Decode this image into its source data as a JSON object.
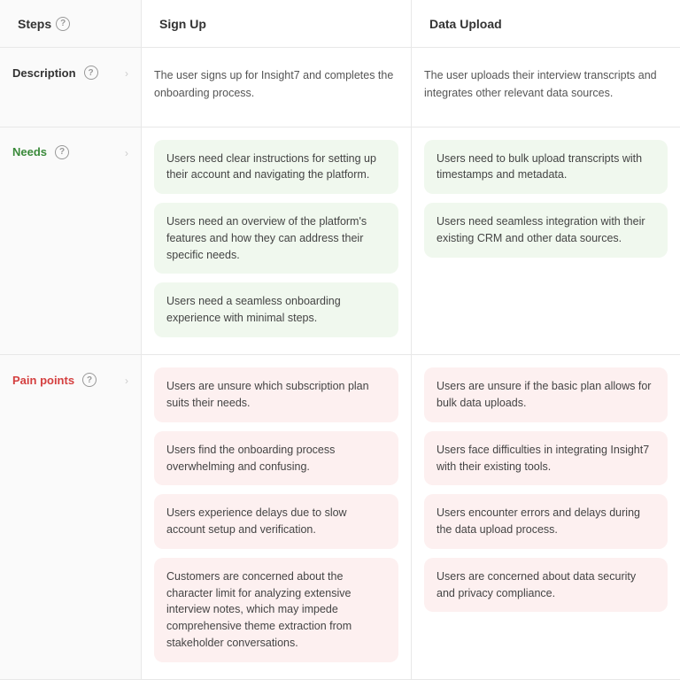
{
  "header": {
    "steps_label": "Steps",
    "signup_label": "Sign Up",
    "data_upload_label": "Data Upload"
  },
  "description": {
    "label": "Description",
    "signup_text": "The user signs up for Insight7 and completes the onboarding process.",
    "data_upload_text": "The user uploads their interview transcripts and integrates other relevant data sources."
  },
  "needs": {
    "label": "Needs",
    "signup_cards": [
      "Users need clear instructions for setting up their account and navigating the platform.",
      "Users need an overview of the platform's features and how they can address their specific needs.",
      "Users need a seamless onboarding experience with minimal steps."
    ],
    "data_upload_cards": [
      "Users need to bulk upload transcripts with timestamps and metadata.",
      "Users need seamless integration with their existing CRM and other data sources."
    ]
  },
  "pain_points": {
    "label": "Pain points",
    "signup_cards": [
      "Users are unsure which subscription plan suits their needs.",
      "Users find the onboarding process overwhelming and confusing.",
      "Users experience delays due to slow account setup and verification.",
      "Customers are concerned about the character limit for analyzing extensive interview notes, which may impede comprehensive theme extraction from stakeholder conversations."
    ],
    "data_upload_cards": [
      "Users are unsure if the basic plan allows for bulk data uploads.",
      "Users face difficulties in integrating Insight7 with their existing tools.",
      "Users encounter errors and delays during the data upload process.",
      "Users are concerned about data security and privacy compliance."
    ]
  },
  "icons": {
    "question": "?",
    "arrow": "›"
  }
}
